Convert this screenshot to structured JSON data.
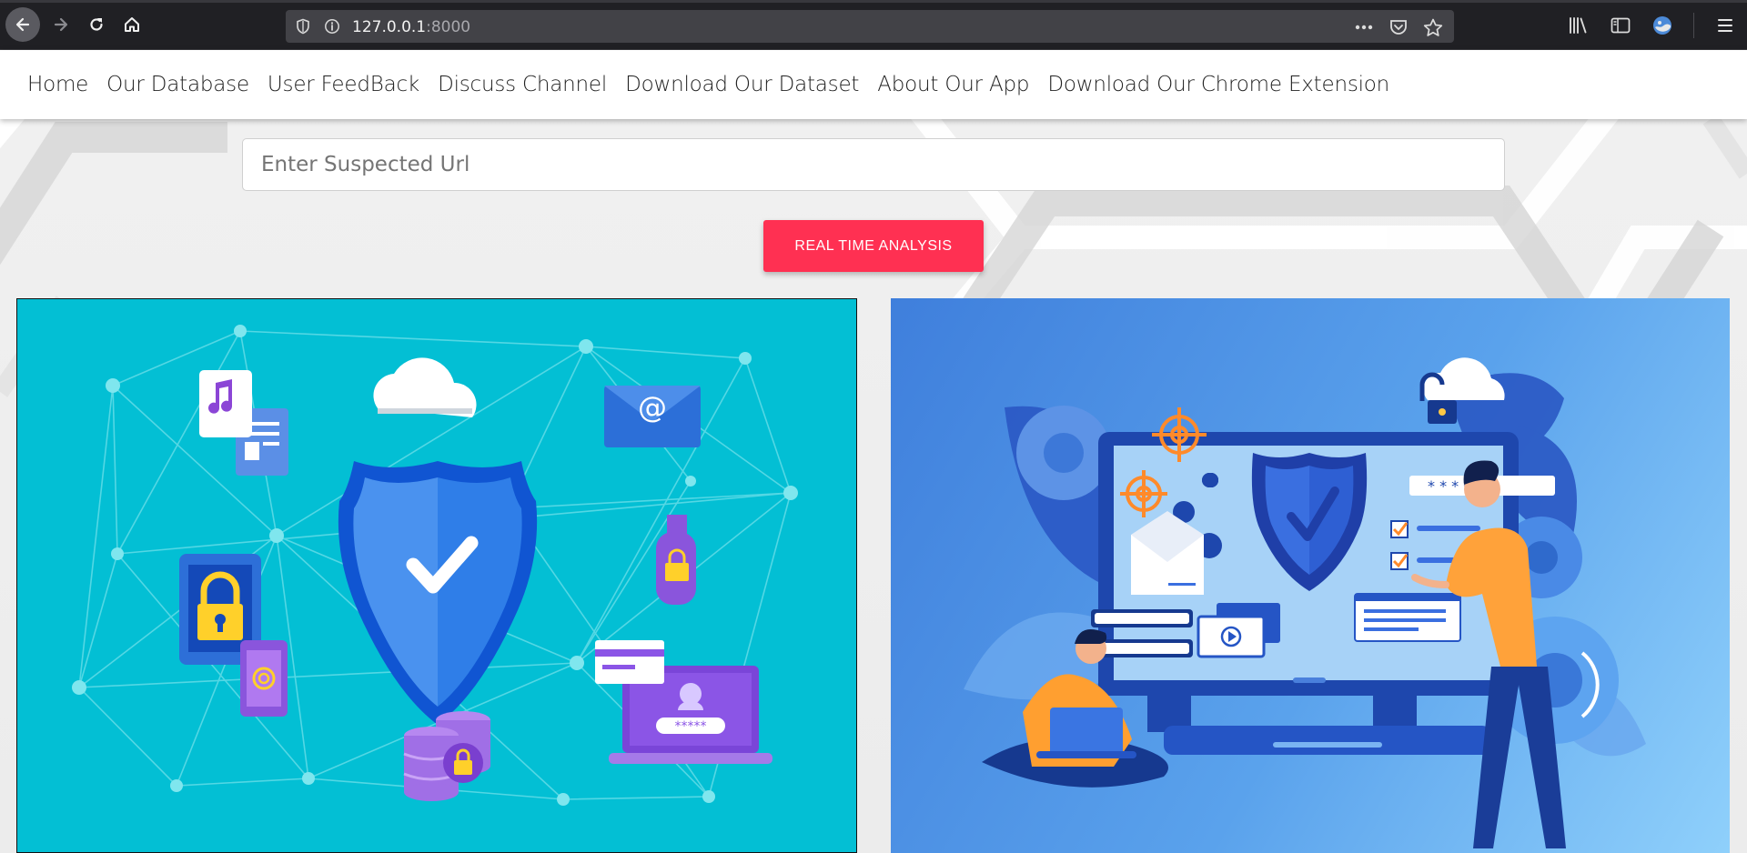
{
  "browser": {
    "url_host": "127.0.0.1",
    "url_port": ":8000"
  },
  "nav": {
    "items": [
      {
        "label": "Home"
      },
      {
        "label": "Our Database"
      },
      {
        "label": "User FeedBack"
      },
      {
        "label": "Discuss Channel"
      },
      {
        "label": "Download Our Dataset"
      },
      {
        "label": "About Our App"
      },
      {
        "label": "Download Our Chrome Extension"
      }
    ]
  },
  "search": {
    "placeholder": "Enter Suspected Url",
    "value": ""
  },
  "analysis_button": {
    "label": "REAL TIME ANALYSIS"
  },
  "illustrations": {
    "left": {
      "icon": "cybersecurity-network-illustration",
      "password_mask": "*****"
    },
    "right": {
      "icon": "security-monitor-illustration",
      "password_mask": "* * * *"
    }
  },
  "colors": {
    "accent": "#ff3052",
    "left_panel": "#03bfd4",
    "right_panel": "#4a90e2"
  }
}
